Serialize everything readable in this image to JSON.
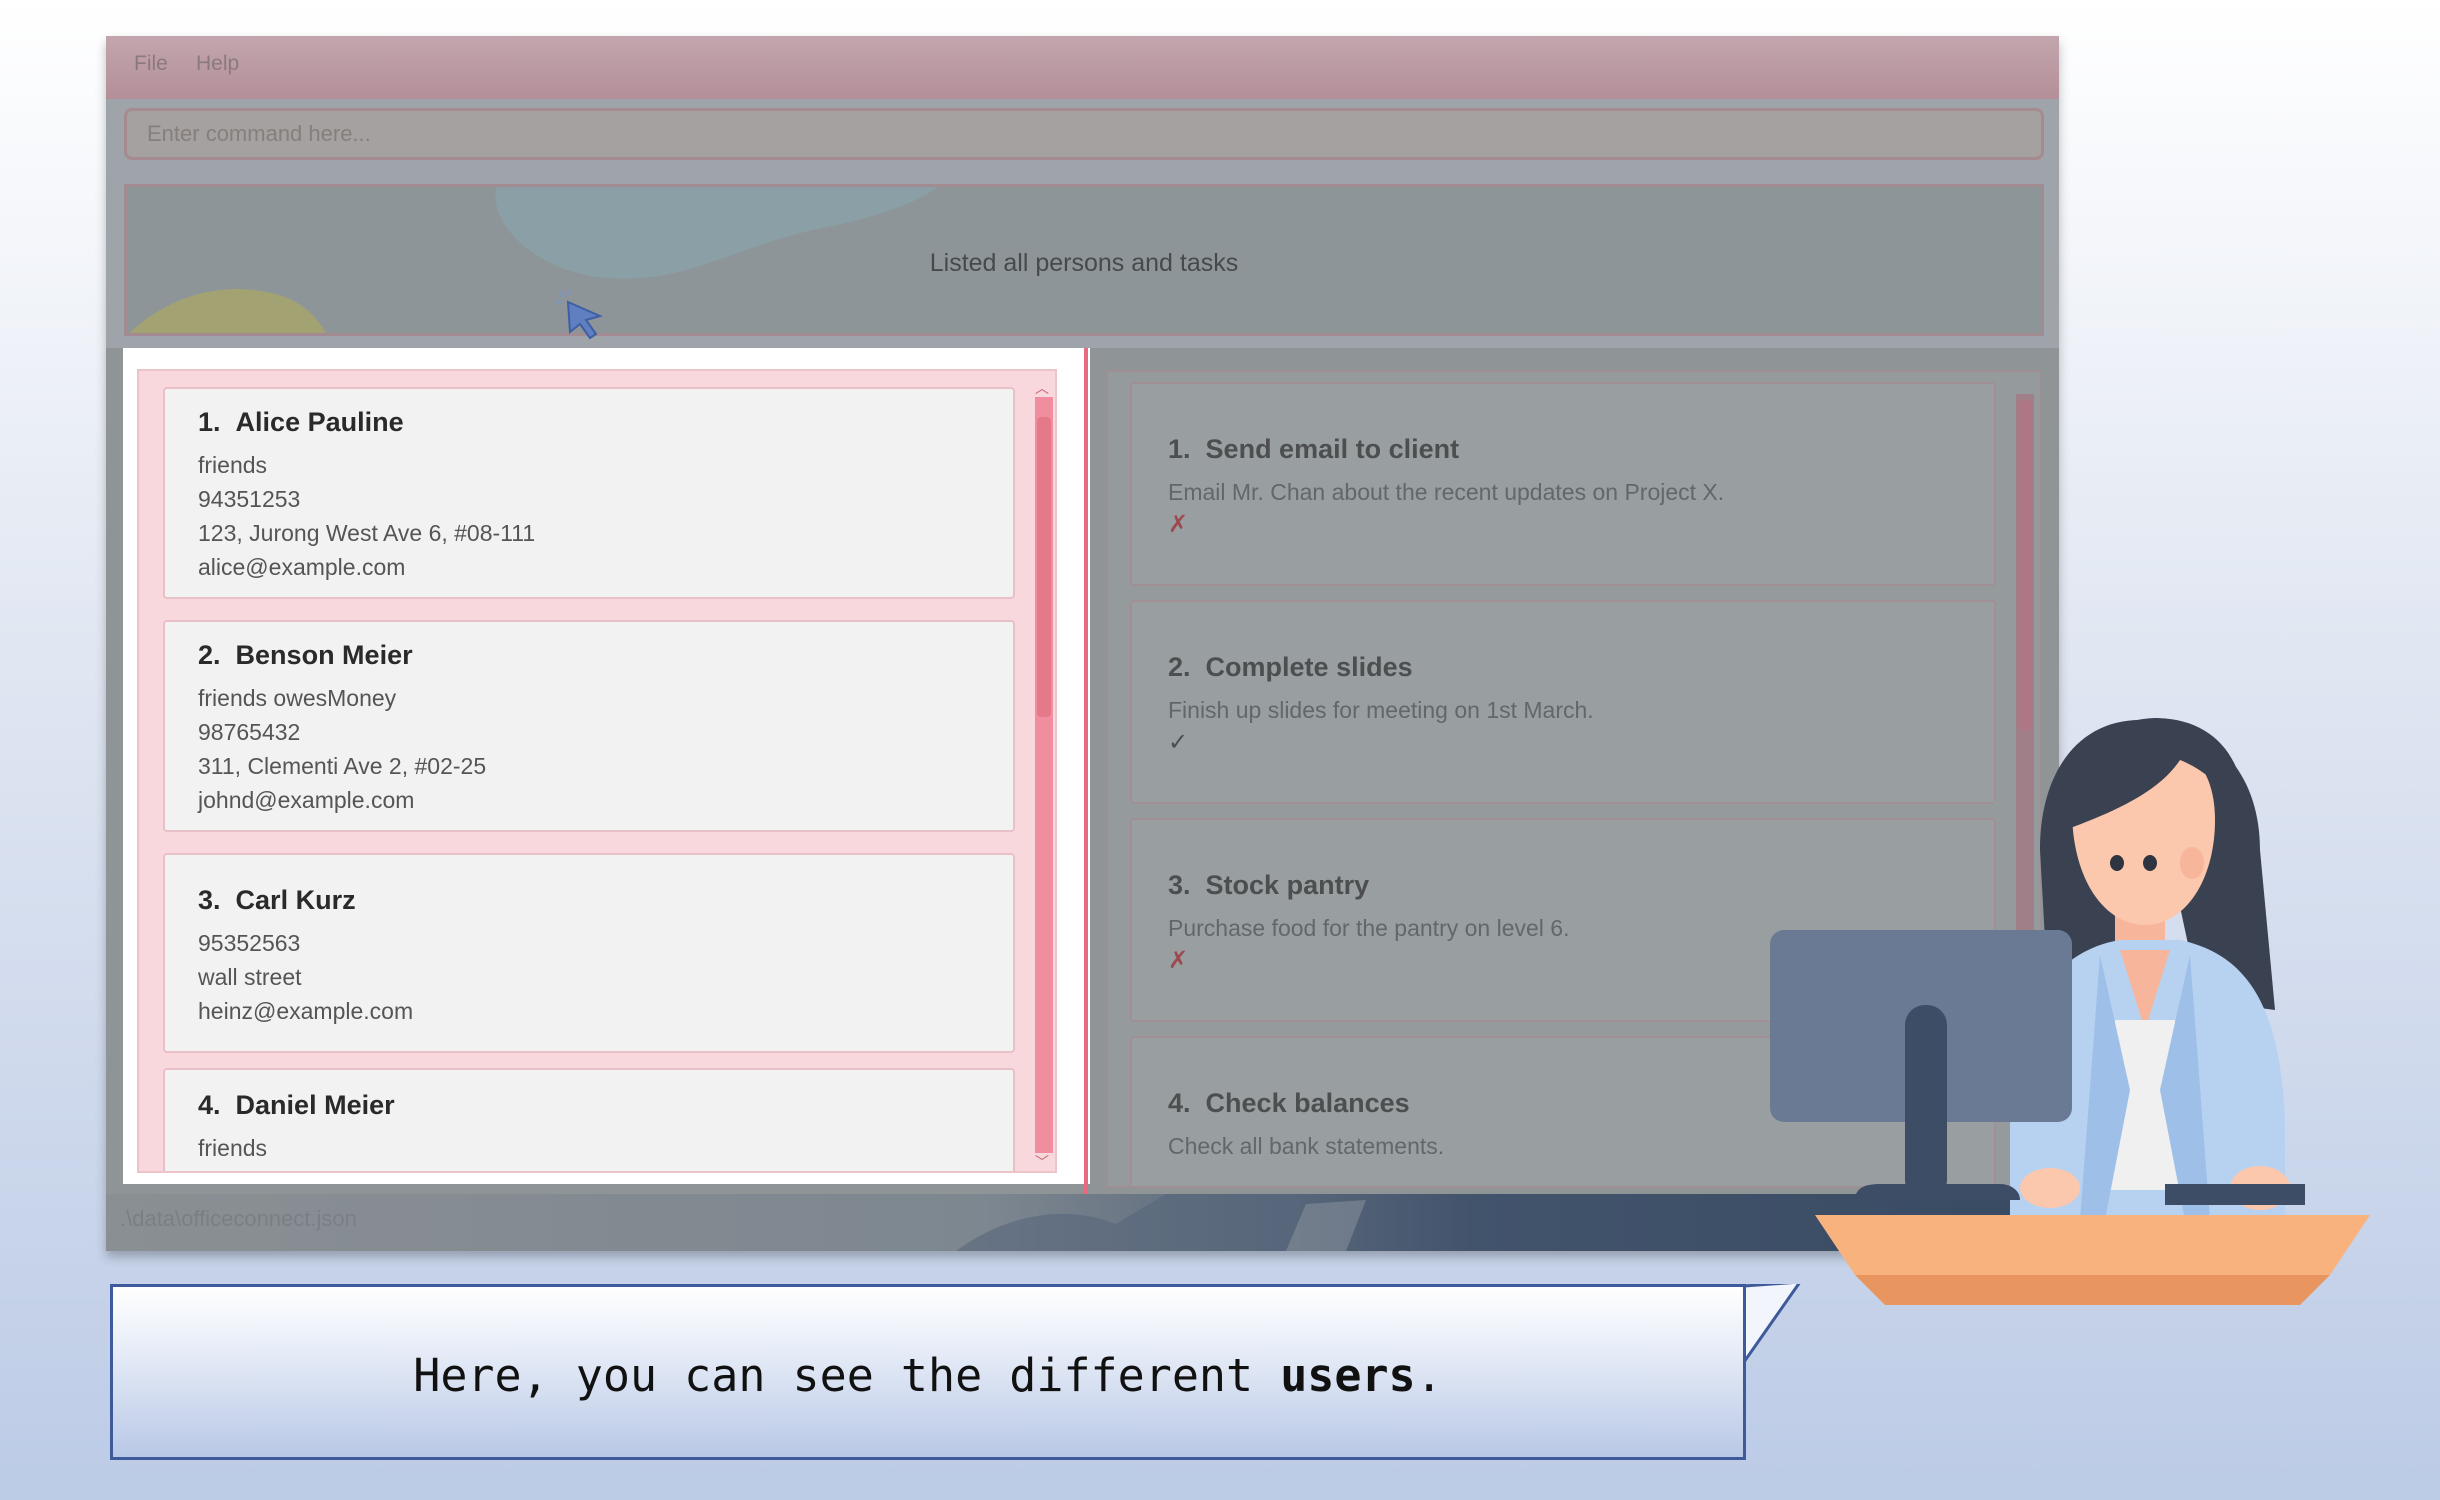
{
  "menu": {
    "items": [
      "File",
      "Help"
    ]
  },
  "command_box": {
    "placeholder": "Enter command here..."
  },
  "result_display": {
    "text": "Listed all persons and tasks"
  },
  "persons": [
    {
      "index": "1.",
      "name": "Alice Pauline",
      "tags": "friends",
      "phone": "94351253",
      "address": "123, Jurong West Ave 6, #08-111",
      "email": "alice@example.com"
    },
    {
      "index": "2.",
      "name": "Benson Meier",
      "tags": "friends  owesMoney",
      "phone": "98765432",
      "address": "311, Clementi Ave 2, #02-25",
      "email": "johnd@example.com"
    },
    {
      "index": "3.",
      "name": "Carl Kurz",
      "tags": "",
      "phone": "95352563",
      "address": "wall street",
      "email": "heinz@example.com"
    },
    {
      "index": "4.",
      "name": "Daniel Meier",
      "tags": "friends",
      "phone": "",
      "address": "",
      "email": ""
    }
  ],
  "tasks": [
    {
      "index": "1.",
      "title": "Send email to client",
      "description": "Email Mr. Chan about the recent updates on Project X.",
      "status": "✗"
    },
    {
      "index": "2.",
      "title": "Complete slides",
      "description": "Finish up slides for meeting on 1st March.",
      "status": "✓"
    },
    {
      "index": "3.",
      "title": "Stock pantry",
      "description": "Purchase food for the pantry on level 6.",
      "status": "✗"
    },
    {
      "index": "4.",
      "title": "Check balances",
      "description": "Check all bank statements.",
      "status": ""
    }
  ],
  "status_bar": {
    "path": ".\\data\\officeconnect.json"
  },
  "tutorial": {
    "text_prefix": "Here, you can see the different ",
    "text_bold": "users",
    "text_suffix": "."
  },
  "colors": {
    "accent_pink": "#f08ea0",
    "bubble_border": "#3e5a9a",
    "overlay_grey": "#9ea4a9"
  },
  "icons": {
    "cursor": "mouse-pointer-icon",
    "assistant": "woman-at-computer-illustration"
  }
}
